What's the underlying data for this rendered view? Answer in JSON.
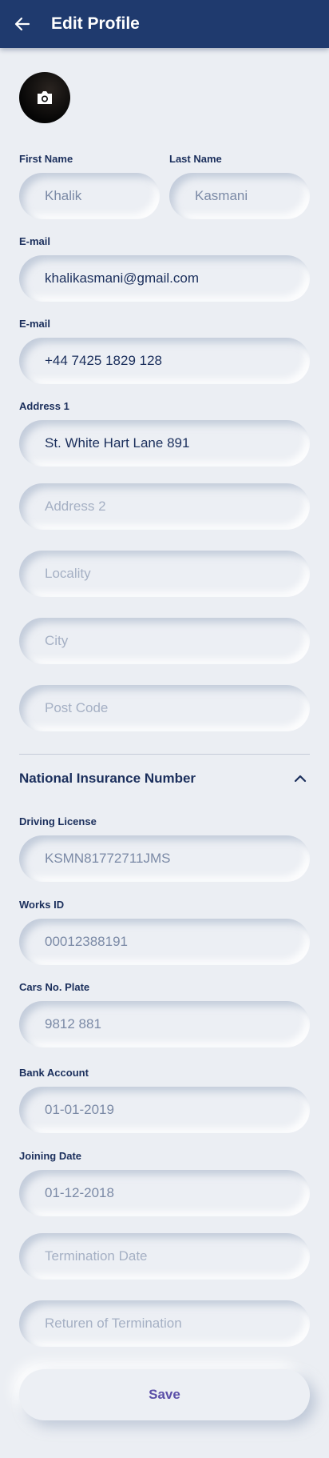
{
  "header": {
    "title": "Edit Profile",
    "back_icon": "arrow-left-icon"
  },
  "avatar": {
    "icon": "camera-icon"
  },
  "form": {
    "first_name": {
      "label": "First Name",
      "value": "Khalik"
    },
    "last_name": {
      "label": "Last Name",
      "value": "Kasmani"
    },
    "email": {
      "label": "E-mail",
      "value": "khalikasmani@gmail.com"
    },
    "phone": {
      "label": "E-mail",
      "value": "+44  7425 1829 128"
    },
    "address1": {
      "label": "Address 1",
      "value": "St. White Hart Lane 891"
    },
    "address2": {
      "placeholder": "Address 2"
    },
    "locality": {
      "placeholder": "Locality"
    },
    "city": {
      "placeholder": "City"
    },
    "post_code": {
      "placeholder": "Post Code"
    }
  },
  "insurance_section": {
    "title": "National Insurance Number",
    "expanded": true,
    "chevron_icon": "chevron-up-icon",
    "driving_license": {
      "label": "Driving License",
      "value": "KSMN81772711JMS"
    },
    "works_id": {
      "label": "Works ID",
      "value": "00012388191"
    },
    "plate": {
      "label": "Cars No. Plate",
      "value": "9812 881"
    },
    "bank_account": {
      "label": "Bank Account",
      "value": "01-01-2019"
    },
    "joining_date": {
      "label": "Joining Date",
      "value": "01-12-2018"
    },
    "termination_date": {
      "placeholder": "Termination Date"
    },
    "termination_reason": {
      "placeholder": "Returen of Termination"
    }
  },
  "actions": {
    "save_label": "Save"
  },
  "colors": {
    "appbar": "#1f3a6e",
    "background": "#ebeef3",
    "text": "#1b2f5c",
    "save_text": "#5b4fa8"
  }
}
